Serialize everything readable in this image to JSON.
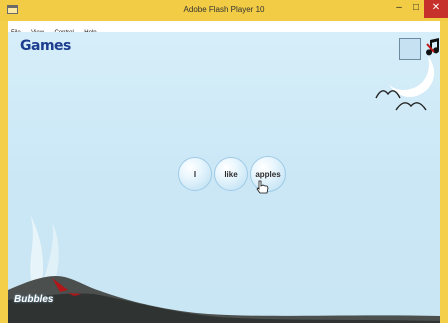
{
  "window": {
    "title": "Adobe Flash Player 10"
  },
  "controls": {
    "minimize": "–",
    "maximize": "□",
    "close": "✕"
  },
  "menu": {
    "items": [
      "File",
      "View",
      "Control",
      "Help"
    ]
  },
  "game": {
    "logo_main": "Games",
    "bubbles": [
      "I",
      "like",
      "apples"
    ],
    "bottom_logo": "Bubbles"
  },
  "icons": {
    "music": "music-note-icon",
    "cursor": "hand-cursor-icon",
    "moon": "moon-icon",
    "birds": "birds-icon",
    "volcano": "volcano-icon"
  },
  "colors": {
    "titlebar": "#f2cc45",
    "close_button": "#c7312b",
    "sky_top": "#d6eef9",
    "sky_bottom": "#c9e6f4",
    "logo_blue": "#1d3d8f"
  }
}
